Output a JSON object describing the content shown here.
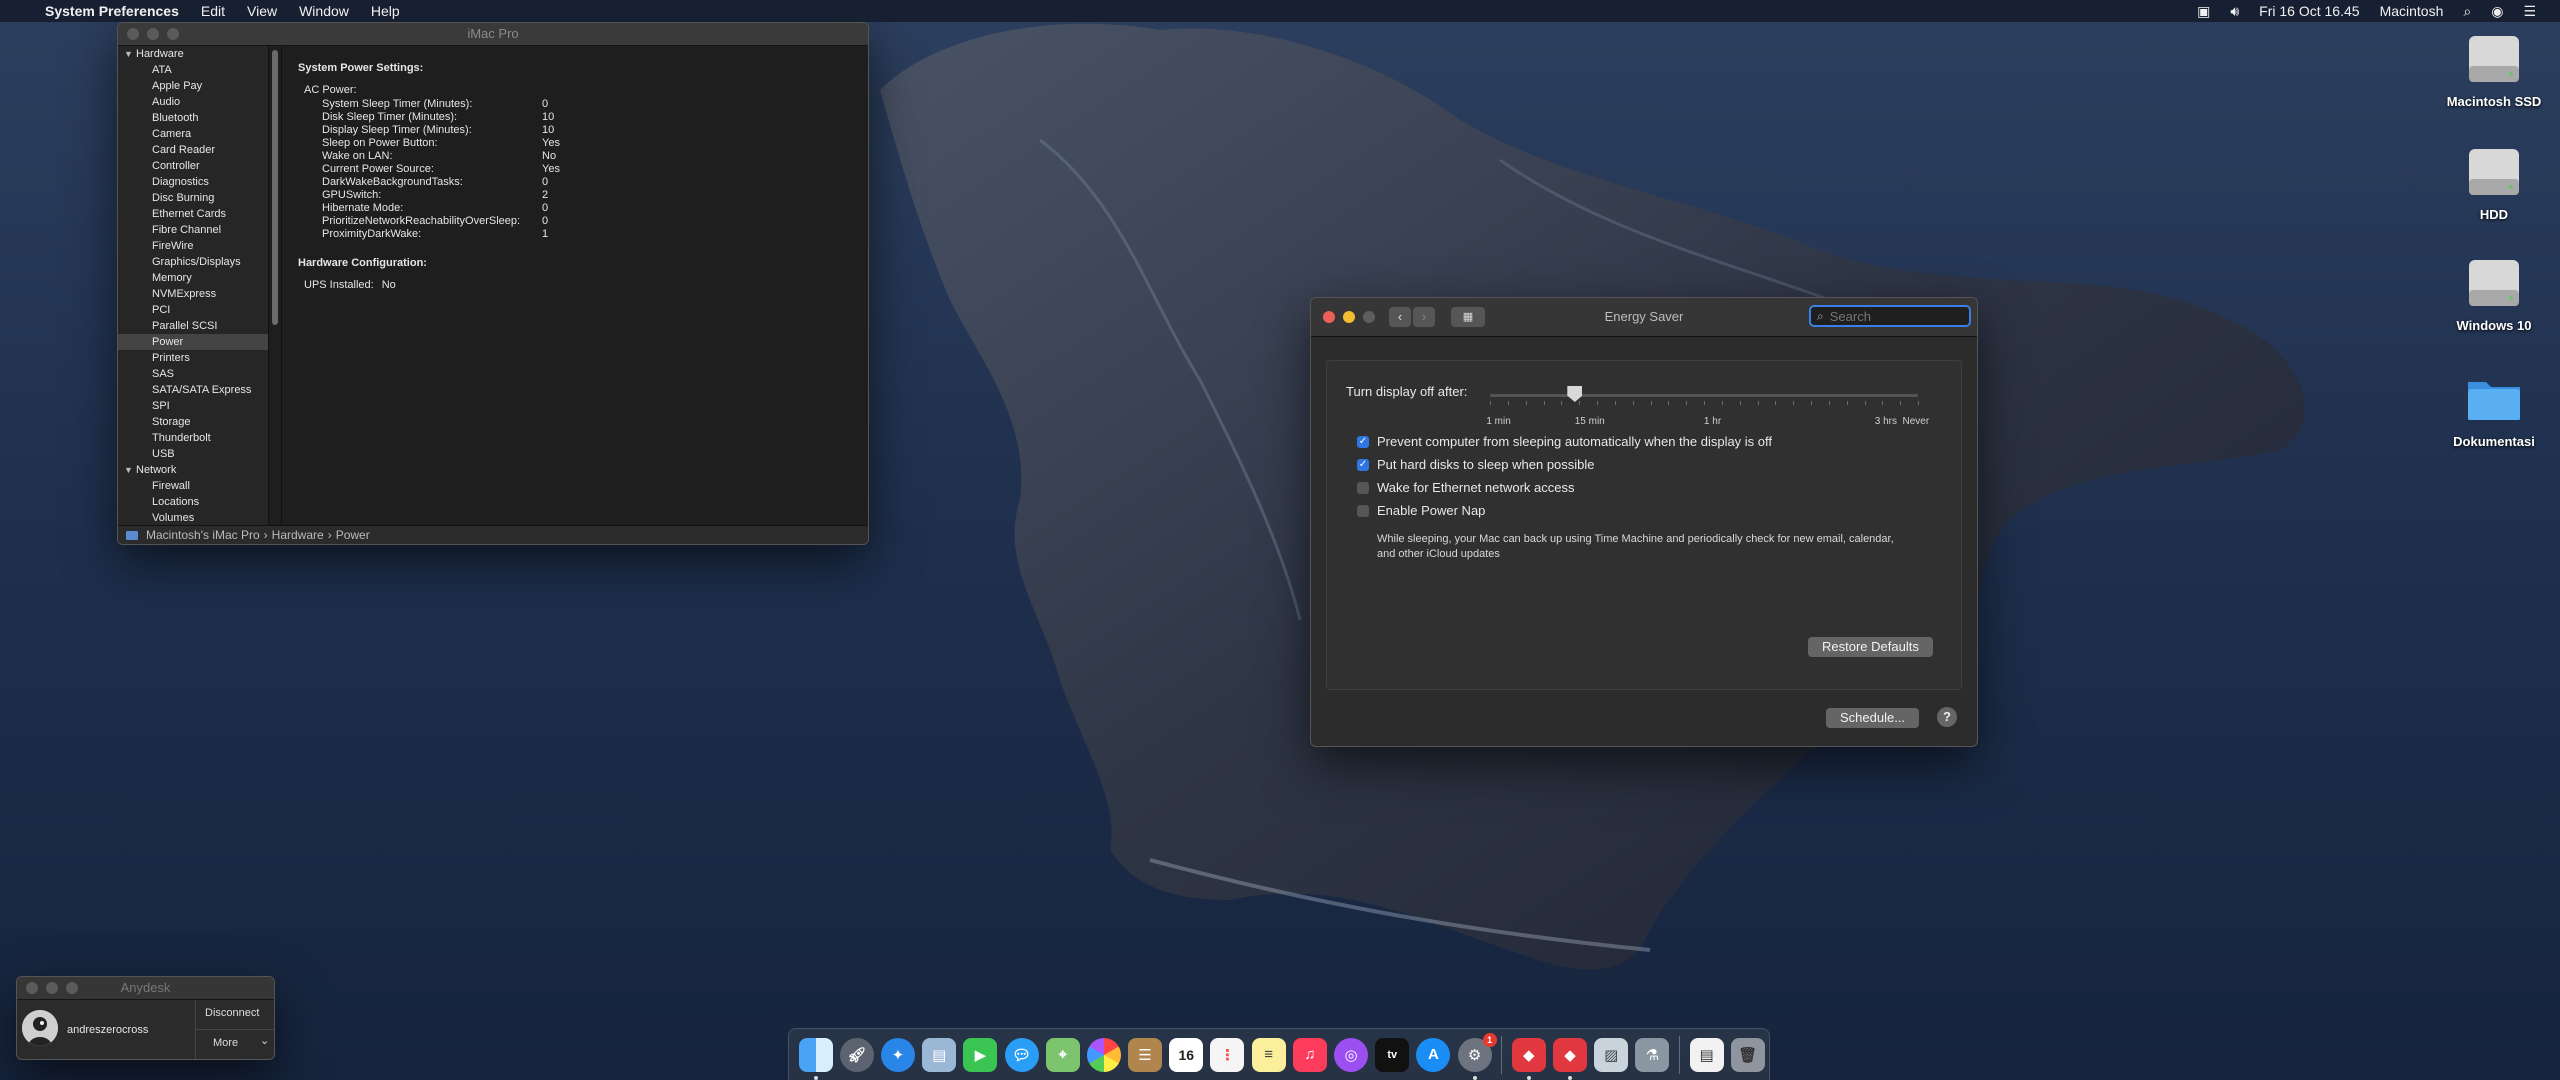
{
  "menubar": {
    "app_name": "System Preferences",
    "menus": [
      "Edit",
      "View",
      "Window",
      "Help"
    ],
    "datetime": "Fri 16 Oct  16.45",
    "user": "Macintosh"
  },
  "sysinfo": {
    "title": "iMac Pro",
    "sidebar": {
      "hardware_label": "Hardware",
      "hardware_items": [
        "ATA",
        "Apple Pay",
        "Audio",
        "Bluetooth",
        "Camera",
        "Card Reader",
        "Controller",
        "Diagnostics",
        "Disc Burning",
        "Ethernet Cards",
        "Fibre Channel",
        "FireWire",
        "Graphics/Displays",
        "Memory",
        "NVMExpress",
        "PCI",
        "Parallel SCSI",
        "Power",
        "Printers",
        "SAS",
        "SATA/SATA Express",
        "SPI",
        "Storage",
        "Thunderbolt",
        "USB"
      ],
      "selected": "Power",
      "network_label": "Network",
      "network_items": [
        "Firewall",
        "Locations",
        "Volumes"
      ]
    },
    "detail": {
      "heading": "System Power Settings:",
      "ac_power_label": "AC Power:",
      "settings": [
        {
          "key": "System Sleep Timer (Minutes):",
          "value": "0"
        },
        {
          "key": "Disk Sleep Timer (Minutes):",
          "value": "10"
        },
        {
          "key": "Display Sleep Timer (Minutes):",
          "value": "10"
        },
        {
          "key": "Sleep on Power Button:",
          "value": "Yes"
        },
        {
          "key": "Wake on LAN:",
          "value": "No"
        },
        {
          "key": "Current Power Source:",
          "value": "Yes"
        },
        {
          "key": "DarkWakeBackgroundTasks:",
          "value": "0"
        },
        {
          "key": "GPUSwitch:",
          "value": "2"
        },
        {
          "key": "Hibernate Mode:",
          "value": "0"
        },
        {
          "key": "PrioritizeNetworkReachabilityOverSleep:",
          "value": "0"
        },
        {
          "key": "ProximityDarkWake:",
          "value": "1"
        }
      ],
      "hw_config_heading": "Hardware Configuration:",
      "ups_label": "UPS Installed:",
      "ups_value": "No"
    },
    "pathbar": [
      "Macintosh's iMac Pro",
      "›",
      "Hardware",
      "›",
      "Power"
    ]
  },
  "energy": {
    "title": "Energy Saver",
    "search_placeholder": "Search",
    "display_off_label": "Turn display off after:",
    "slider": {
      "value_fraction": 0.197,
      "labels": [
        {
          "text": "1 min",
          "pos": 0.02
        },
        {
          "text": "15 min",
          "pos": 0.233
        },
        {
          "text": "1 hr",
          "pos": 0.52
        },
        {
          "text": "3 hrs",
          "pos": 0.925
        },
        {
          "text": "Never",
          "pos": 0.995
        }
      ]
    },
    "options": [
      {
        "label": "Prevent computer from sleeping automatically when the display is off",
        "checked": true
      },
      {
        "label": "Put hard disks to sleep when possible",
        "checked": true
      },
      {
        "label": "Wake for Ethernet network access",
        "checked": false
      },
      {
        "label": "Enable Power Nap",
        "checked": false
      }
    ],
    "power_nap_desc": "While sleeping, your Mac can back up using Time Machine and periodically check for new email, calendar, and other iCloud updates",
    "restore_label": "Restore Defaults",
    "schedule_label": "Schedule...",
    "help_label": "?"
  },
  "anydesk": {
    "title": "Anydesk",
    "user": "andreszerocross",
    "disconnect_label": "Disconnect",
    "more_label": "More"
  },
  "desktop_icons": [
    {
      "label": "Macintosh SSD",
      "type": "disk"
    },
    {
      "label": "HDD",
      "type": "disk"
    },
    {
      "label": "Windows 10",
      "type": "disk"
    },
    {
      "label": "Dokumentasi",
      "type": "folder"
    }
  ],
  "dock": {
    "calendar_day": "16",
    "badge_count": "1",
    "apps": [
      "Finder",
      "Launchpad",
      "Safari",
      "Preview",
      "FaceTime",
      "Messages",
      "Maps",
      "Photos",
      "Contacts",
      "Calendar",
      "Reminders",
      "Notes",
      "Music",
      "Podcasts",
      "TV",
      "App Store",
      "System Preferences",
      "AnyDesk",
      "AnyDesk Helper",
      "Preview Doc",
      "Script",
      "Document",
      "Trash"
    ]
  },
  "colors": {
    "accent": "#2f76e3",
    "close": "#ee5f57",
    "minimize": "#f3bd30"
  }
}
